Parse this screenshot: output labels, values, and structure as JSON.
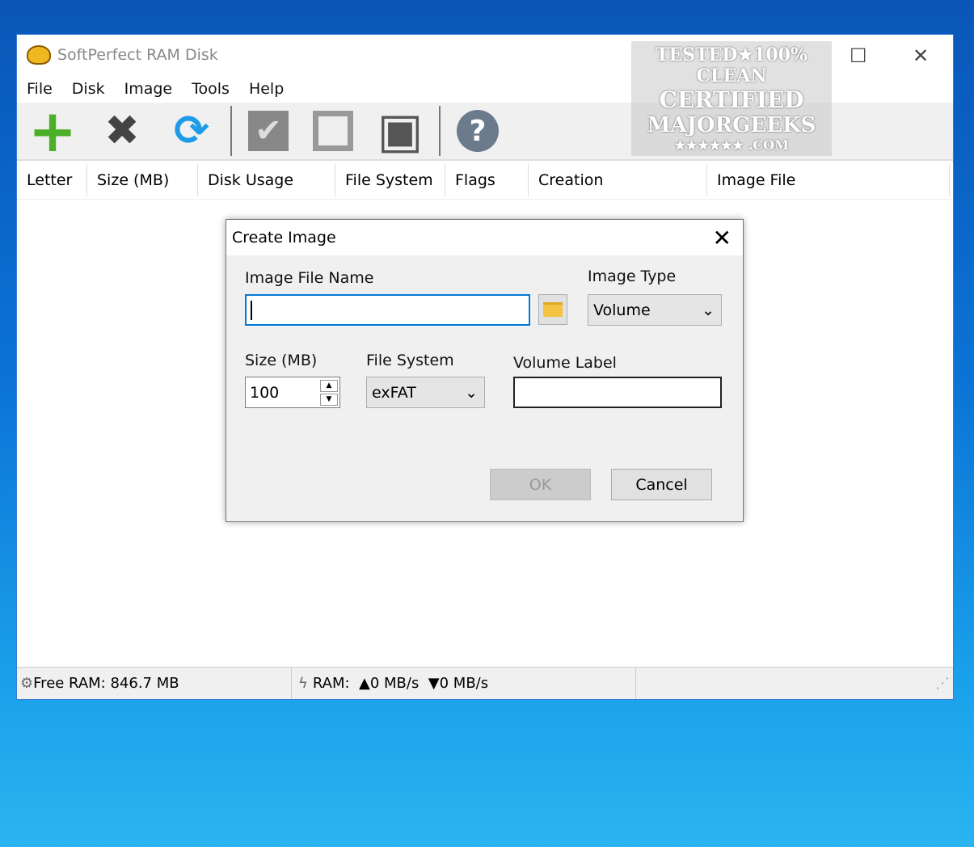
{
  "app": {
    "title": "SoftPerfect RAM Disk"
  },
  "menu": [
    "File",
    "Disk",
    "Image",
    "Tools",
    "Help"
  ],
  "toolbar": [
    {
      "icon": "add-icon",
      "glyph": "+"
    },
    {
      "icon": "remove-icon",
      "glyph": "✖"
    },
    {
      "icon": "refresh-icon",
      "glyph": "⟳"
    },
    {
      "icon": "mount-icon",
      "glyph": "✔"
    },
    {
      "icon": "unmount-icon",
      "glyph": "□"
    },
    {
      "icon": "save-icon",
      "glyph": "▣"
    },
    {
      "icon": "help-icon",
      "glyph": "?"
    }
  ],
  "columns": [
    "Letter",
    "Size (MB)",
    "Disk Usage",
    "File System",
    "Flags",
    "Creation",
    "Image File"
  ],
  "watermark": [
    "TESTED★100% CLEAN",
    "CERTIFIED",
    "MAJORGEEKS",
    "★★★★★★ .COM"
  ],
  "status": {
    "free_ram": "Free RAM: 846.7 MB",
    "ram_speed": "RAM:  ▲0 MB/s  ▼0 MB/s"
  },
  "dialog": {
    "title": "Create Image",
    "image_file_name_label": "Image File Name",
    "image_file_name": "",
    "image_type_label": "Image Type",
    "image_type": "Volume",
    "size_label": "Size (MB)",
    "size": "100",
    "fs_label": "File System",
    "fs": "exFAT",
    "volume_label_label": "Volume Label",
    "volume_label": "",
    "ok": "OK",
    "cancel": "Cancel"
  }
}
